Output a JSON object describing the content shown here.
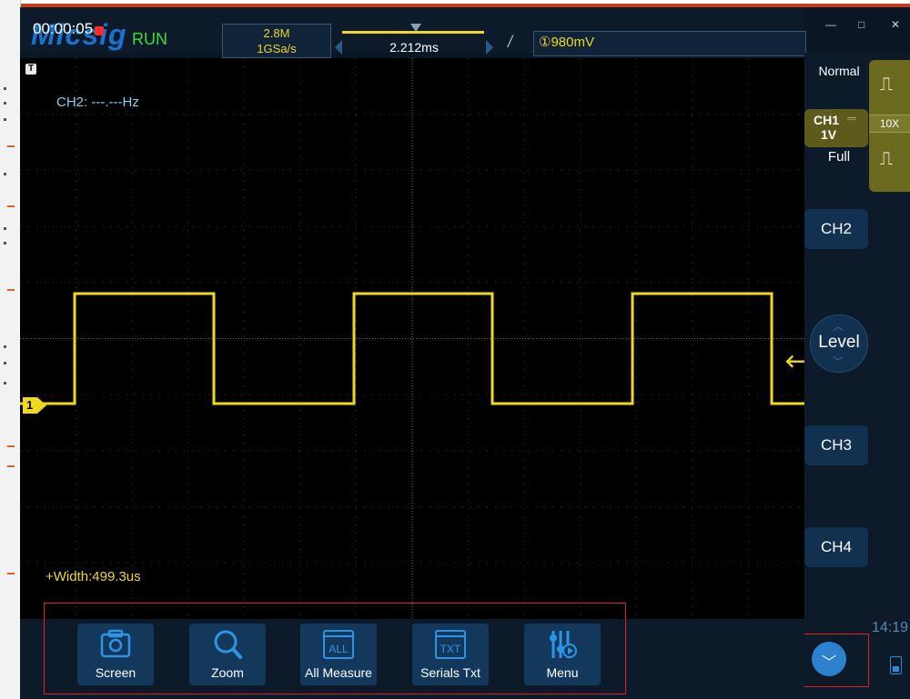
{
  "status": {
    "logo": "Micsig",
    "timer": "00:00:05",
    "run_state": "RUN",
    "memory_depth": "2.8M",
    "sample_rate": "1GSa/s",
    "timebase": "2.212ms",
    "trigger_level": "①980mV"
  },
  "window": {
    "minimize": "—",
    "maximize": "□",
    "close": "✕"
  },
  "screen": {
    "trigger_marker": "T",
    "ch2_frequency": "CH2: ---.---Hz",
    "width_measurement": "+Width:499.3us",
    "ch1_marker": "1"
  },
  "right_panel": {
    "trigger_mode": "Normal",
    "ch1_name": "CH1",
    "ch1_coupling": "⎓",
    "ch1_scale": "1V",
    "bandwidth": "Full",
    "probe_ratio": "10X",
    "ch2": "CH2",
    "level": "Level",
    "ch3": "CH3",
    "ch4": "CH4",
    "clock": "14:19"
  },
  "toolbar": {
    "screen": "Screen",
    "zoom": "Zoom",
    "all_measure": "All Measure",
    "all_icon_text": "ALL",
    "serials_txt": "Serials Txt",
    "txt_icon_text": "TXT",
    "menu": "Menu"
  },
  "colors": {
    "ch1_trace": "#f0d820",
    "run": "#38e038",
    "ch2_text": "#7fd7ef",
    "accent": "#2d82cf"
  },
  "icons": [
    "camera-icon",
    "magnifier-icon",
    "all-measure-icon",
    "serials-txt-icon",
    "menu-icon",
    "chevron-down-icon",
    "battery-icon",
    "pulse-icon"
  ]
}
